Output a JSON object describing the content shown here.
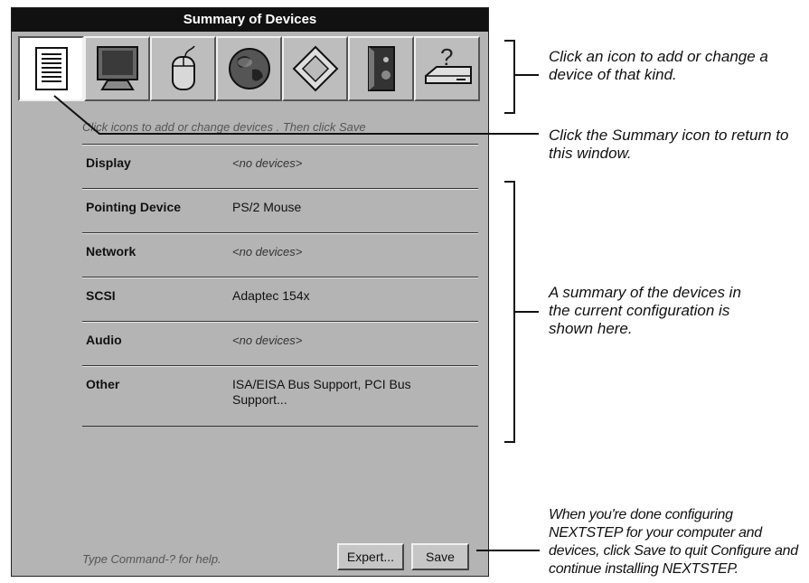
{
  "window": {
    "title": "Summary of Devices"
  },
  "toolbar": {
    "icons": [
      {
        "name": "summary-icon",
        "label": "Summary"
      },
      {
        "name": "display-icon",
        "label": "Display"
      },
      {
        "name": "mouse-icon",
        "label": "Pointing Device"
      },
      {
        "name": "globe-icon",
        "label": "Network"
      },
      {
        "name": "scsi-icon",
        "label": "SCSI"
      },
      {
        "name": "audio-icon",
        "label": "Audio"
      },
      {
        "name": "other-icon",
        "label": "Other"
      }
    ],
    "selected": "summary-icon"
  },
  "hint": "Click icons to add or change devices . Then click Save",
  "devices": [
    {
      "name": "Display",
      "value": "<no devices>"
    },
    {
      "name": "Pointing Device",
      "value": "PS/2 Mouse"
    },
    {
      "name": "Network",
      "value": "<no devices>"
    },
    {
      "name": "SCSI",
      "value": "Adaptec 154x"
    },
    {
      "name": "Audio",
      "value": "<no devices>"
    },
    {
      "name": "Other",
      "value": "ISA/EISA Bus Support, PCI Bus Support..."
    }
  ],
  "footer": {
    "help": "Type Command-? for help.",
    "expert_label": "Expert...",
    "save_label": "Save"
  },
  "annotations": {
    "icons": "Click an icon to add or change a device of that kind.",
    "summary_icon": "Click the Summary icon to return to this window.",
    "summary_area": "A summary of the devices in the current configuration is shown here.",
    "save": "When you're done configuring NEXTSTEP for your computer and devices, click Save to quit Configure and continue installing NEXTSTEP."
  }
}
